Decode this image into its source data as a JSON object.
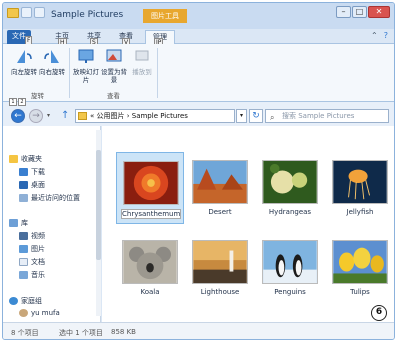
{
  "window": {
    "title": "Sample Pictures",
    "context_tab": "图片工具"
  },
  "winbtns": {
    "minimize": "–",
    "maximize": "□",
    "close": "✕"
  },
  "tabs": {
    "file": "文件",
    "home": "主页",
    "share": "共享",
    "view": "查看",
    "manage": "管理",
    "keytips": {
      "file": "F",
      "home": "H",
      "share": "S",
      "view": "V",
      "manage": "JP"
    }
  },
  "ribbon": {
    "rotate_left": "向左旋转",
    "rotate_right": "向右旋转",
    "slideshow": "放映幻灯片",
    "set_background": "设置为背景",
    "cast_to": "播放到",
    "group_rotate": "旋转",
    "group_view": "查看"
  },
  "address": {
    "path": "« 公用图片 › Sample Pictures",
    "search_placeholder": "搜索 Sample Pictures"
  },
  "nav": {
    "favorites": "收藏夹",
    "downloads": "下载",
    "desktop": "桌面",
    "recent": "最近访问的位置",
    "libraries": "库",
    "videos": "视频",
    "pictures": "图片",
    "documents": "文档",
    "music": "音乐",
    "homegroup": "家庭组",
    "user": "yu mufa"
  },
  "files": [
    {
      "name": "Chrysanthemum",
      "selected": true
    },
    {
      "name": "Desert",
      "selected": false
    },
    {
      "name": "Hydrangeas",
      "selected": false
    },
    {
      "name": "Jellyfish",
      "selected": false
    },
    {
      "name": "Koala",
      "selected": false
    },
    {
      "name": "Lighthouse",
      "selected": false
    },
    {
      "name": "Penguins",
      "selected": false
    },
    {
      "name": "Tulips",
      "selected": false
    }
  ],
  "status": {
    "count": "8 个项目",
    "selected": "选中 1 个项目",
    "size": "858 KB"
  },
  "annotation": "6",
  "colors": {
    "accent": "#2a68b4",
    "context_tab": "#e8a72f",
    "selection": "#cce4f7"
  }
}
